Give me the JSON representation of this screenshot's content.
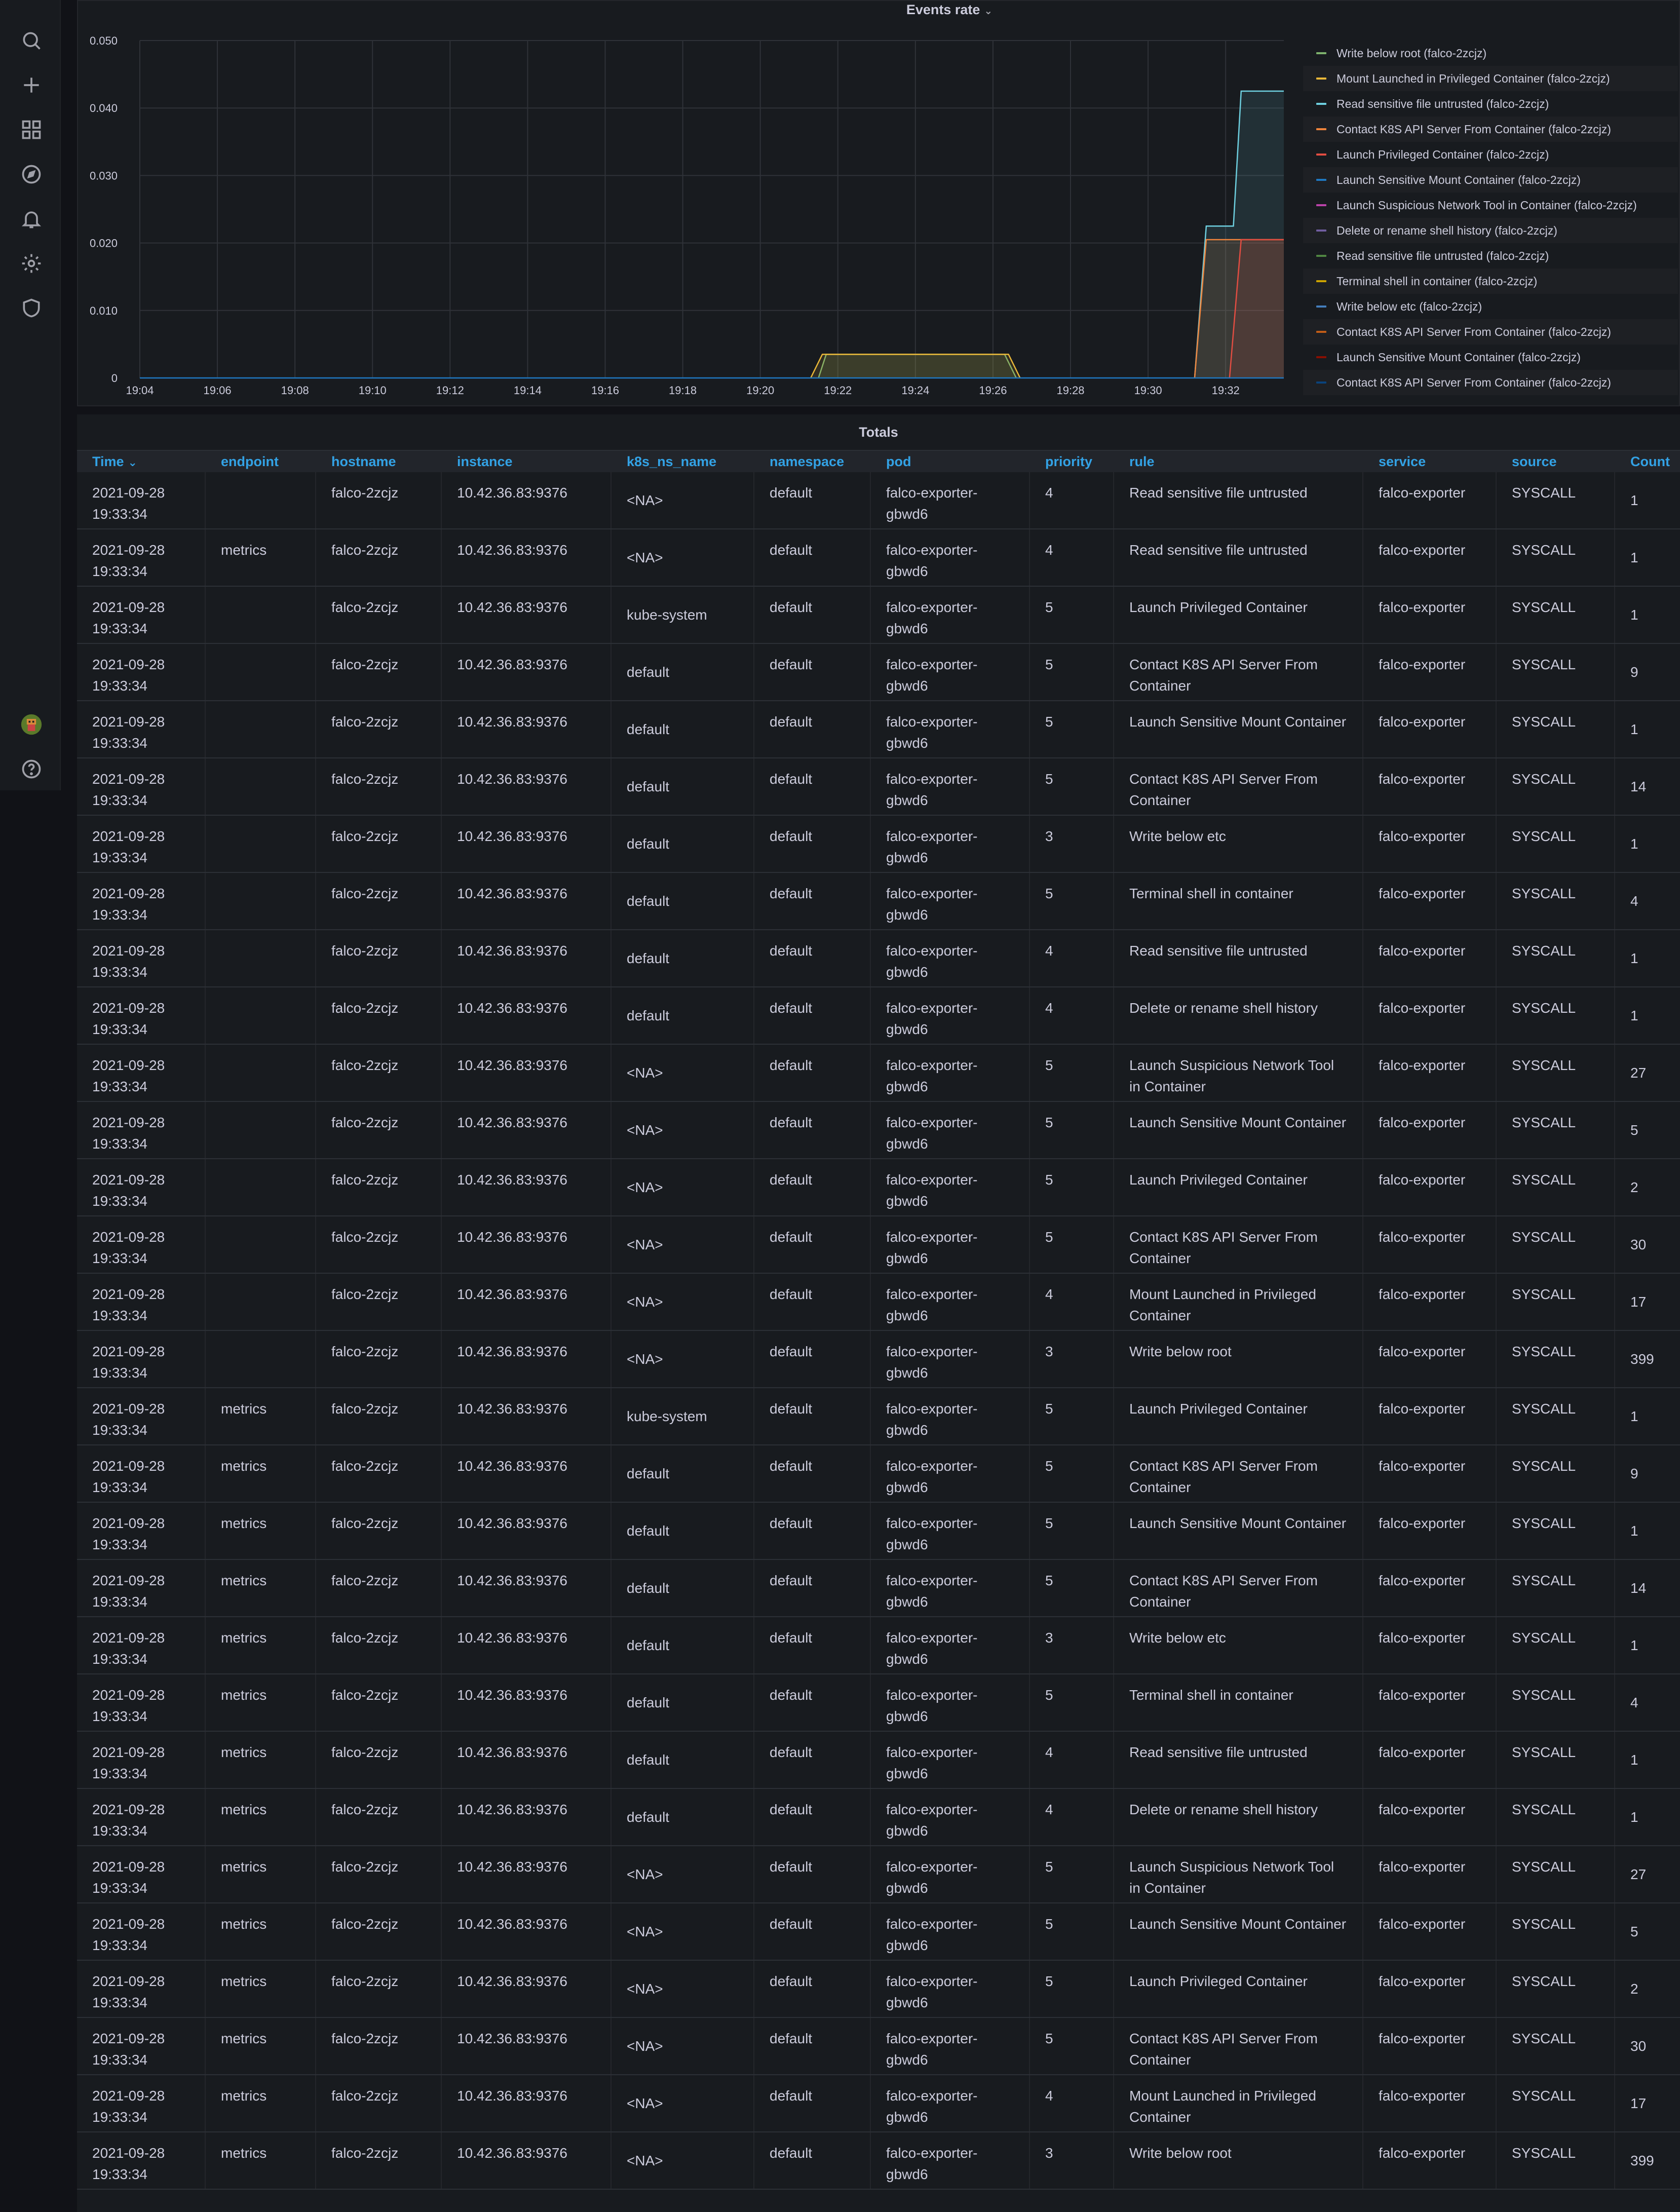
{
  "sidebar": {
    "icons": [
      "search-icon",
      "plus-icon",
      "dashboards-icon",
      "explore-icon",
      "alerting-icon",
      "settings-icon",
      "shield-icon"
    ],
    "bottom_icons": [
      "avatar",
      "help-icon"
    ]
  },
  "chart": {
    "title": "Events rate",
    "legend": [
      {
        "label": "Write below root (falco-2zcjz)",
        "color": "#7eb26d"
      },
      {
        "label": "Mount Launched in Privileged Container (falco-2zcjz)",
        "color": "#eab839"
      },
      {
        "label": "Read sensitive file untrusted (falco-2zcjz)",
        "color": "#6ed0e0"
      },
      {
        "label": "Contact K8S API Server From Container (falco-2zcjz)",
        "color": "#ef843c"
      },
      {
        "label": "Launch Privileged Container (falco-2zcjz)",
        "color": "#e24d42"
      },
      {
        "label": "Launch Sensitive Mount Container (falco-2zcjz)",
        "color": "#1f78c1"
      },
      {
        "label": "Launch Suspicious Network Tool in Container (falco-2zcjz)",
        "color": "#ba43a9"
      },
      {
        "label": "Delete or rename shell history (falco-2zcjz)",
        "color": "#705da0"
      },
      {
        "label": "Read sensitive file untrusted (falco-2zcjz)",
        "color": "#508642"
      },
      {
        "label": "Terminal shell in container (falco-2zcjz)",
        "color": "#cca300"
      },
      {
        "label": "Write below etc (falco-2zcjz)",
        "color": "#447ebc"
      },
      {
        "label": "Contact K8S API Server From Container (falco-2zcjz)",
        "color": "#c15c17"
      },
      {
        "label": "Launch Sensitive Mount Container (falco-2zcjz)",
        "color": "#890f02"
      },
      {
        "label": "Contact K8S API Server From Container (falco-2zcjz)",
        "color": "#0a437c"
      }
    ]
  },
  "chart_data": {
    "type": "area",
    "title": "Events rate",
    "x_ticks": [
      "19:04",
      "19:06",
      "19:08",
      "19:10",
      "19:12",
      "19:14",
      "19:16",
      "19:18",
      "19:20",
      "19:22",
      "19:24",
      "19:26",
      "19:28",
      "19:30",
      "19:32"
    ],
    "y_ticks": [
      "0",
      "0.010",
      "0.020",
      "0.030",
      "0.040",
      "0.050"
    ],
    "ylim": [
      0,
      0.05
    ],
    "grid": true,
    "legend_position": "right",
    "series": [
      {
        "name": "Write below root (falco-2zcjz)",
        "color": "#7eb26d",
        "points": [
          [
            "19:21.5",
            0
          ],
          [
            "19:21.7",
            0.0035
          ],
          [
            "19:26.3",
            0.0035
          ],
          [
            "19:26.6",
            0
          ]
        ]
      },
      {
        "name": "Mount Launched in Privileged Container (falco-2zcjz)",
        "color": "#eab839",
        "points": [
          [
            "19:21.3",
            0
          ],
          [
            "19:21.6",
            0.0035
          ],
          [
            "19:26.4",
            0.0035
          ],
          [
            "19:26.7",
            0
          ]
        ]
      },
      {
        "name": "Read sensitive file untrusted (falco-2zcjz)",
        "color": "#6ed0e0",
        "points": [
          [
            "19:31.2",
            0
          ],
          [
            "19:31.5",
            0.0225
          ],
          [
            "19:32.2",
            0.0225
          ],
          [
            "19:32.4",
            0.0425
          ],
          [
            "19:33.5",
            0.0425
          ]
        ]
      },
      {
        "name": "Contact K8S API Server From Container (falco-2zcjz)",
        "color": "#ef843c",
        "points": [
          [
            "19:31.2",
            0
          ],
          [
            "19:31.5",
            0.0205
          ],
          [
            "19:33.5",
            0.0205
          ]
        ]
      },
      {
        "name": "Launch Privileged Container (falco-2zcjz)",
        "color": "#e24d42",
        "points": [
          [
            "19:32.1",
            0
          ],
          [
            "19:32.4",
            0.0205
          ],
          [
            "19:33.5",
            0.0205
          ]
        ]
      },
      {
        "name": "Launch Sensitive Mount Container (falco-2zcjz)",
        "color": "#1f78c1",
        "points": [
          [
            "19:04",
            0
          ],
          [
            "19:33.5",
            0
          ]
        ]
      }
    ]
  },
  "table": {
    "title": "Totals",
    "columns": [
      "Time",
      "endpoint",
      "hostname",
      "instance",
      "k8s_ns_name",
      "namespace",
      "pod",
      "priority",
      "rule",
      "service",
      "source",
      "Count"
    ],
    "sort_indicator": "⌄",
    "rows": [
      {
        "time": "2021-09-28 19:33:34",
        "endpoint": "",
        "hostname": "falco-2zcjz",
        "instance": "10.42.36.83:9376",
        "k8s": "<NA>",
        "namespace": "default",
        "pod": "falco-exporter-gbwd6",
        "priority": "4",
        "rule": "Read sensitive file untrusted",
        "service": "falco-exporter",
        "source": "SYSCALL",
        "count": "1"
      },
      {
        "time": "2021-09-28 19:33:34",
        "endpoint": "metrics",
        "hostname": "falco-2zcjz",
        "instance": "10.42.36.83:9376",
        "k8s": "<NA>",
        "namespace": "default",
        "pod": "falco-exporter-gbwd6",
        "priority": "4",
        "rule": "Read sensitive file untrusted",
        "service": "falco-exporter",
        "source": "SYSCALL",
        "count": "1"
      },
      {
        "time": "2021-09-28 19:33:34",
        "endpoint": "",
        "hostname": "falco-2zcjz",
        "instance": "10.42.36.83:9376",
        "k8s": "kube-system",
        "namespace": "default",
        "pod": "falco-exporter-gbwd6",
        "priority": "5",
        "rule": "Launch Privileged Container",
        "service": "falco-exporter",
        "source": "SYSCALL",
        "count": "1"
      },
      {
        "time": "2021-09-28 19:33:34",
        "endpoint": "",
        "hostname": "falco-2zcjz",
        "instance": "10.42.36.83:9376",
        "k8s": "default",
        "namespace": "default",
        "pod": "falco-exporter-gbwd6",
        "priority": "5",
        "rule": "Contact K8S API Server From Container",
        "service": "falco-exporter",
        "source": "SYSCALL",
        "count": "9"
      },
      {
        "time": "2021-09-28 19:33:34",
        "endpoint": "",
        "hostname": "falco-2zcjz",
        "instance": "10.42.36.83:9376",
        "k8s": "default",
        "namespace": "default",
        "pod": "falco-exporter-gbwd6",
        "priority": "5",
        "rule": "Launch Sensitive Mount Container",
        "service": "falco-exporter",
        "source": "SYSCALL",
        "count": "1"
      },
      {
        "time": "2021-09-28 19:33:34",
        "endpoint": "",
        "hostname": "falco-2zcjz",
        "instance": "10.42.36.83:9376",
        "k8s": "default",
        "namespace": "default",
        "pod": "falco-exporter-gbwd6",
        "priority": "5",
        "rule": "Contact K8S API Server From Container",
        "service": "falco-exporter",
        "source": "SYSCALL",
        "count": "14"
      },
      {
        "time": "2021-09-28 19:33:34",
        "endpoint": "",
        "hostname": "falco-2zcjz",
        "instance": "10.42.36.83:9376",
        "k8s": "default",
        "namespace": "default",
        "pod": "falco-exporter-gbwd6",
        "priority": "3",
        "rule": "Write below etc",
        "service": "falco-exporter",
        "source": "SYSCALL",
        "count": "1"
      },
      {
        "time": "2021-09-28 19:33:34",
        "endpoint": "",
        "hostname": "falco-2zcjz",
        "instance": "10.42.36.83:9376",
        "k8s": "default",
        "namespace": "default",
        "pod": "falco-exporter-gbwd6",
        "priority": "5",
        "rule": "Terminal shell in container",
        "service": "falco-exporter",
        "source": "SYSCALL",
        "count": "4"
      },
      {
        "time": "2021-09-28 19:33:34",
        "endpoint": "",
        "hostname": "falco-2zcjz",
        "instance": "10.42.36.83:9376",
        "k8s": "default",
        "namespace": "default",
        "pod": "falco-exporter-gbwd6",
        "priority": "4",
        "rule": "Read sensitive file untrusted",
        "service": "falco-exporter",
        "source": "SYSCALL",
        "count": "1"
      },
      {
        "time": "2021-09-28 19:33:34",
        "endpoint": "",
        "hostname": "falco-2zcjz",
        "instance": "10.42.36.83:9376",
        "k8s": "default",
        "namespace": "default",
        "pod": "falco-exporter-gbwd6",
        "priority": "4",
        "rule": "Delete or rename shell history",
        "service": "falco-exporter",
        "source": "SYSCALL",
        "count": "1"
      },
      {
        "time": "2021-09-28 19:33:34",
        "endpoint": "",
        "hostname": "falco-2zcjz",
        "instance": "10.42.36.83:9376",
        "k8s": "<NA>",
        "namespace": "default",
        "pod": "falco-exporter-gbwd6",
        "priority": "5",
        "rule": "Launch Suspicious Network Tool in Container",
        "service": "falco-exporter",
        "source": "SYSCALL",
        "count": "27"
      },
      {
        "time": "2021-09-28 19:33:34",
        "endpoint": "",
        "hostname": "falco-2zcjz",
        "instance": "10.42.36.83:9376",
        "k8s": "<NA>",
        "namespace": "default",
        "pod": "falco-exporter-gbwd6",
        "priority": "5",
        "rule": "Launch Sensitive Mount Container",
        "service": "falco-exporter",
        "source": "SYSCALL",
        "count": "5"
      },
      {
        "time": "2021-09-28 19:33:34",
        "endpoint": "",
        "hostname": "falco-2zcjz",
        "instance": "10.42.36.83:9376",
        "k8s": "<NA>",
        "namespace": "default",
        "pod": "falco-exporter-gbwd6",
        "priority": "5",
        "rule": "Launch Privileged Container",
        "service": "falco-exporter",
        "source": "SYSCALL",
        "count": "2"
      },
      {
        "time": "2021-09-28 19:33:34",
        "endpoint": "",
        "hostname": "falco-2zcjz",
        "instance": "10.42.36.83:9376",
        "k8s": "<NA>",
        "namespace": "default",
        "pod": "falco-exporter-gbwd6",
        "priority": "5",
        "rule": "Contact K8S API Server From Container",
        "service": "falco-exporter",
        "source": "SYSCALL",
        "count": "30"
      },
      {
        "time": "2021-09-28 19:33:34",
        "endpoint": "",
        "hostname": "falco-2zcjz",
        "instance": "10.42.36.83:9376",
        "k8s": "<NA>",
        "namespace": "default",
        "pod": "falco-exporter-gbwd6",
        "priority": "4",
        "rule": "Mount Launched in Privileged Container",
        "service": "falco-exporter",
        "source": "SYSCALL",
        "count": "17"
      },
      {
        "time": "2021-09-28 19:33:34",
        "endpoint": "",
        "hostname": "falco-2zcjz",
        "instance": "10.42.36.83:9376",
        "k8s": "<NA>",
        "namespace": "default",
        "pod": "falco-exporter-gbwd6",
        "priority": "3",
        "rule": "Write below root",
        "service": "falco-exporter",
        "source": "SYSCALL",
        "count": "399"
      },
      {
        "time": "2021-09-28 19:33:34",
        "endpoint": "metrics",
        "hostname": "falco-2zcjz",
        "instance": "10.42.36.83:9376",
        "k8s": "kube-system",
        "namespace": "default",
        "pod": "falco-exporter-gbwd6",
        "priority": "5",
        "rule": "Launch Privileged Container",
        "service": "falco-exporter",
        "source": "SYSCALL",
        "count": "1"
      },
      {
        "time": "2021-09-28 19:33:34",
        "endpoint": "metrics",
        "hostname": "falco-2zcjz",
        "instance": "10.42.36.83:9376",
        "k8s": "default",
        "namespace": "default",
        "pod": "falco-exporter-gbwd6",
        "priority": "5",
        "rule": "Contact K8S API Server From Container",
        "service": "falco-exporter",
        "source": "SYSCALL",
        "count": "9"
      },
      {
        "time": "2021-09-28 19:33:34",
        "endpoint": "metrics",
        "hostname": "falco-2zcjz",
        "instance": "10.42.36.83:9376",
        "k8s": "default",
        "namespace": "default",
        "pod": "falco-exporter-gbwd6",
        "priority": "5",
        "rule": "Launch Sensitive Mount Container",
        "service": "falco-exporter",
        "source": "SYSCALL",
        "count": "1"
      },
      {
        "time": "2021-09-28 19:33:34",
        "endpoint": "metrics",
        "hostname": "falco-2zcjz",
        "instance": "10.42.36.83:9376",
        "k8s": "default",
        "namespace": "default",
        "pod": "falco-exporter-gbwd6",
        "priority": "5",
        "rule": "Contact K8S API Server From Container",
        "service": "falco-exporter",
        "source": "SYSCALL",
        "count": "14"
      },
      {
        "time": "2021-09-28 19:33:34",
        "endpoint": "metrics",
        "hostname": "falco-2zcjz",
        "instance": "10.42.36.83:9376",
        "k8s": "default",
        "namespace": "default",
        "pod": "falco-exporter-gbwd6",
        "priority": "3",
        "rule": "Write below etc",
        "service": "falco-exporter",
        "source": "SYSCALL",
        "count": "1"
      },
      {
        "time": "2021-09-28 19:33:34",
        "endpoint": "metrics",
        "hostname": "falco-2zcjz",
        "instance": "10.42.36.83:9376",
        "k8s": "default",
        "namespace": "default",
        "pod": "falco-exporter-gbwd6",
        "priority": "5",
        "rule": "Terminal shell in container",
        "service": "falco-exporter",
        "source": "SYSCALL",
        "count": "4"
      },
      {
        "time": "2021-09-28 19:33:34",
        "endpoint": "metrics",
        "hostname": "falco-2zcjz",
        "instance": "10.42.36.83:9376",
        "k8s": "default",
        "namespace": "default",
        "pod": "falco-exporter-gbwd6",
        "priority": "4",
        "rule": "Read sensitive file untrusted",
        "service": "falco-exporter",
        "source": "SYSCALL",
        "count": "1"
      },
      {
        "time": "2021-09-28 19:33:34",
        "endpoint": "metrics",
        "hostname": "falco-2zcjz",
        "instance": "10.42.36.83:9376",
        "k8s": "default",
        "namespace": "default",
        "pod": "falco-exporter-gbwd6",
        "priority": "4",
        "rule": "Delete or rename shell history",
        "service": "falco-exporter",
        "source": "SYSCALL",
        "count": "1"
      },
      {
        "time": "2021-09-28 19:33:34",
        "endpoint": "metrics",
        "hostname": "falco-2zcjz",
        "instance": "10.42.36.83:9376",
        "k8s": "<NA>",
        "namespace": "default",
        "pod": "falco-exporter-gbwd6",
        "priority": "5",
        "rule": "Launch Suspicious Network Tool in Container",
        "service": "falco-exporter",
        "source": "SYSCALL",
        "count": "27"
      },
      {
        "time": "2021-09-28 19:33:34",
        "endpoint": "metrics",
        "hostname": "falco-2zcjz",
        "instance": "10.42.36.83:9376",
        "k8s": "<NA>",
        "namespace": "default",
        "pod": "falco-exporter-gbwd6",
        "priority": "5",
        "rule": "Launch Sensitive Mount Container",
        "service": "falco-exporter",
        "source": "SYSCALL",
        "count": "5"
      },
      {
        "time": "2021-09-28 19:33:34",
        "endpoint": "metrics",
        "hostname": "falco-2zcjz",
        "instance": "10.42.36.83:9376",
        "k8s": "<NA>",
        "namespace": "default",
        "pod": "falco-exporter-gbwd6",
        "priority": "5",
        "rule": "Launch Privileged Container",
        "service": "falco-exporter",
        "source": "SYSCALL",
        "count": "2"
      },
      {
        "time": "2021-09-28 19:33:34",
        "endpoint": "metrics",
        "hostname": "falco-2zcjz",
        "instance": "10.42.36.83:9376",
        "k8s": "<NA>",
        "namespace": "default",
        "pod": "falco-exporter-gbwd6",
        "priority": "5",
        "rule": "Contact K8S API Server From Container",
        "service": "falco-exporter",
        "source": "SYSCALL",
        "count": "30"
      },
      {
        "time": "2021-09-28 19:33:34",
        "endpoint": "metrics",
        "hostname": "falco-2zcjz",
        "instance": "10.42.36.83:9376",
        "k8s": "<NA>",
        "namespace": "default",
        "pod": "falco-exporter-gbwd6",
        "priority": "4",
        "rule": "Mount Launched in Privileged Container",
        "service": "falco-exporter",
        "source": "SYSCALL",
        "count": "17"
      },
      {
        "time": "2021-09-28 19:33:34",
        "endpoint": "metrics",
        "hostname": "falco-2zcjz",
        "instance": "10.42.36.83:9376",
        "k8s": "<NA>",
        "namespace": "default",
        "pod": "falco-exporter-gbwd6",
        "priority": "3",
        "rule": "Write below root",
        "service": "falco-exporter",
        "source": "SYSCALL",
        "count": "399"
      }
    ]
  }
}
